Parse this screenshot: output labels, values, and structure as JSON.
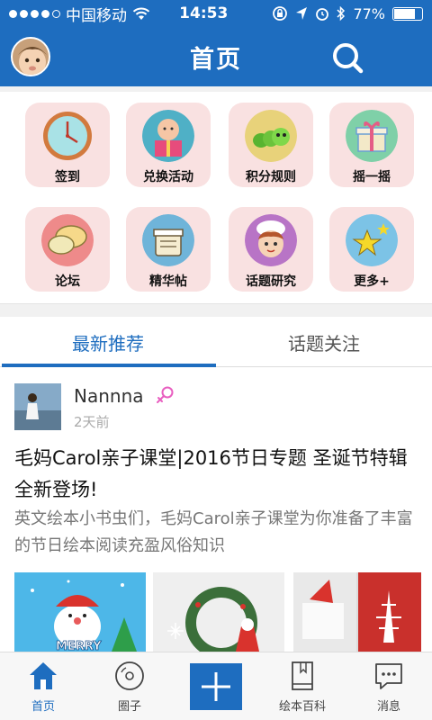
{
  "status_bar": {
    "carrier": "中国移动",
    "time": "14:53",
    "battery_percent": "77%",
    "battery_level": 0.77
  },
  "header": {
    "title": "首页"
  },
  "quick_menu": [
    {
      "label": "签到",
      "icon": "clock-icon"
    },
    {
      "label": "兑换活动",
      "icon": "gift-baby-icon"
    },
    {
      "label": "积分规则",
      "icon": "caterpillar-icon"
    },
    {
      "label": "摇一摇",
      "icon": "gift-box-icon"
    },
    {
      "label": "论坛",
      "icon": "speech-bubbles-icon"
    },
    {
      "label": "精华帖",
      "icon": "basket-icon"
    },
    {
      "label": "话题研究",
      "icon": "chef-girl-icon"
    },
    {
      "label": "更多+",
      "icon": "stars-icon"
    }
  ],
  "tabs": [
    {
      "label": "最新推荐",
      "active": true
    },
    {
      "label": "话题关注",
      "active": false
    }
  ],
  "post": {
    "username": "Nannna",
    "time": "2天前",
    "title": "毛妈Carol亲子课堂|2016节日专题 圣诞节特辑全新登场!",
    "summary": "英文绘本小书虫们，毛妈Carol亲子课堂为你准备了丰富的节日绘本阅读充盈风俗知识",
    "thumb_1_text": "MERRY"
  },
  "bottom_nav": [
    {
      "label": "首页",
      "icon": "home-icon",
      "active": true
    },
    {
      "label": "圈子",
      "icon": "disc-icon",
      "active": false
    },
    {
      "label": "",
      "icon": "plus-icon",
      "active": false
    },
    {
      "label": "绘本百科",
      "icon": "book-icon",
      "active": false
    },
    {
      "label": "消息",
      "icon": "message-icon",
      "active": false
    }
  ],
  "colors": {
    "brand": "#1e6dbf",
    "tile_bg": "#f9e1e1"
  }
}
